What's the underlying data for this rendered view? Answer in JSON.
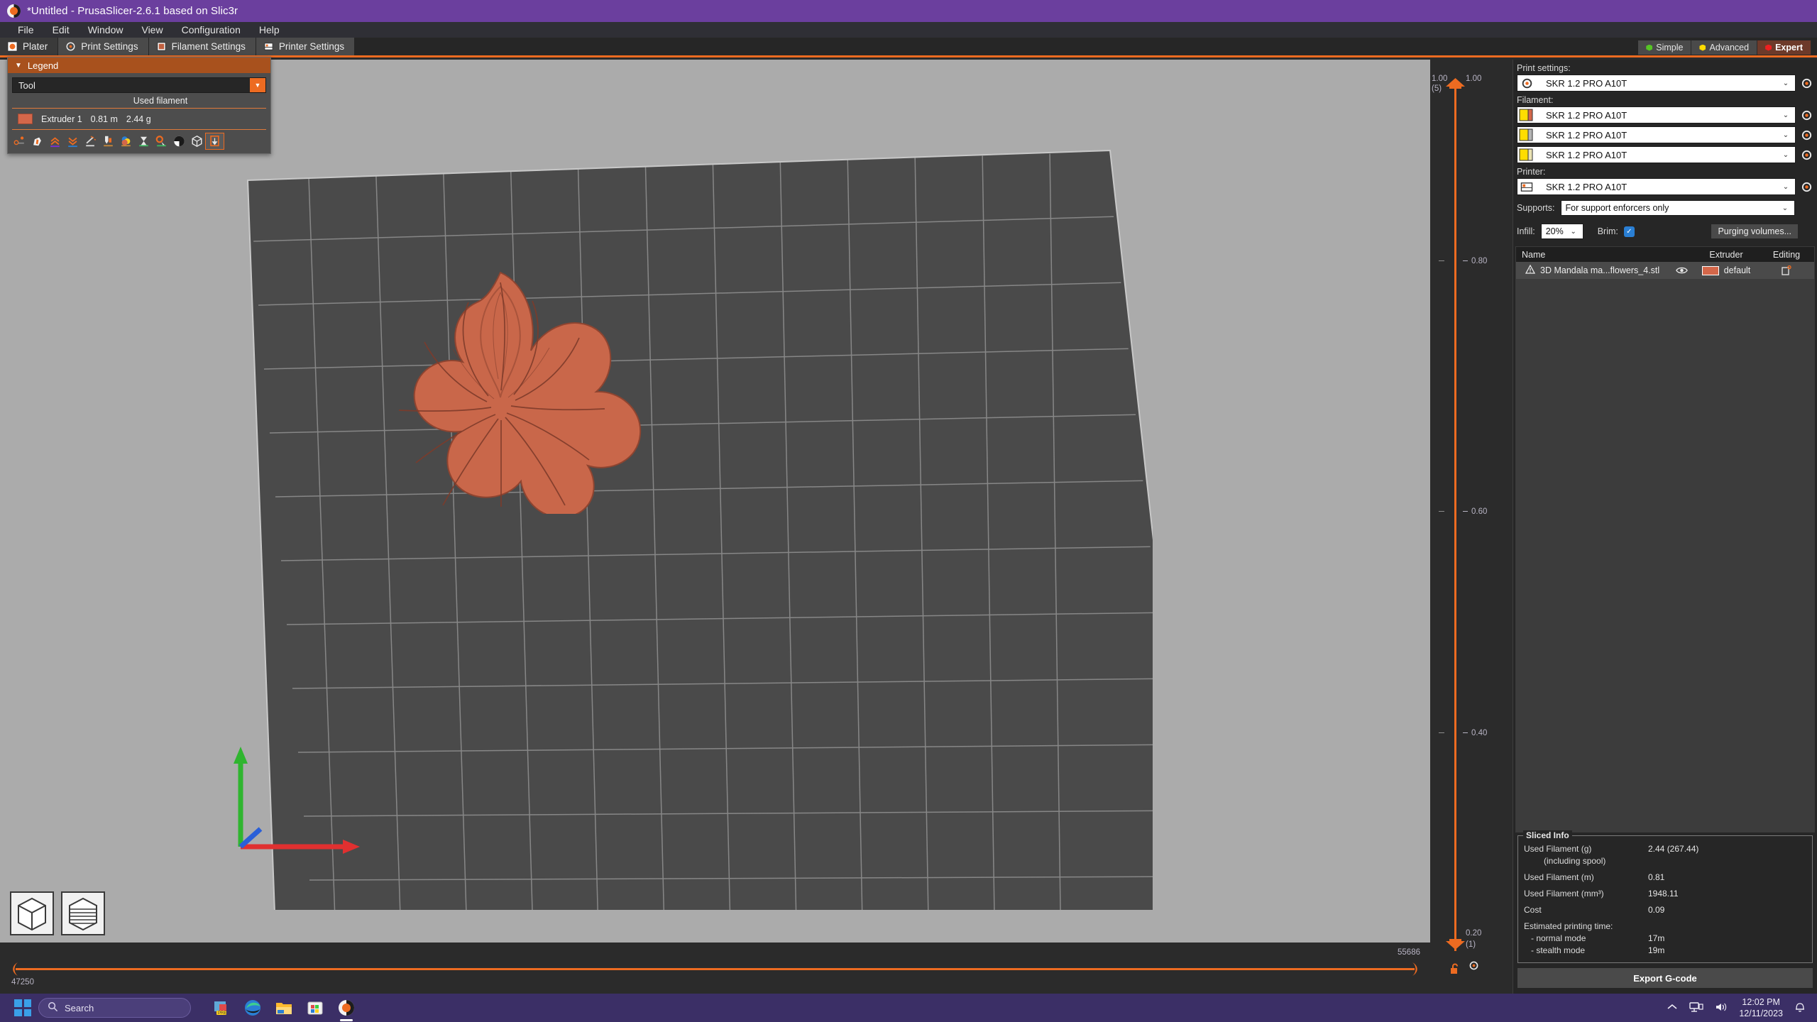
{
  "window": {
    "title": "*Untitled - PrusaSlicer-2.6.1 based on Slic3r",
    "logo_icon": "prusaslicer-logo-icon"
  },
  "menu": {
    "items": [
      {
        "label": "File"
      },
      {
        "label": "Edit"
      },
      {
        "label": "Window"
      },
      {
        "label": "View"
      },
      {
        "label": "Configuration"
      },
      {
        "label": "Help"
      }
    ]
  },
  "tabs": [
    {
      "label": "Plater",
      "icon": "plater-icon",
      "active": true
    },
    {
      "label": "Print Settings",
      "icon": "print-settings-icon",
      "active": false
    },
    {
      "label": "Filament Settings",
      "icon": "filament-settings-icon",
      "active": false
    },
    {
      "label": "Printer Settings",
      "icon": "printer-settings-icon",
      "active": false
    }
  ],
  "modes": [
    {
      "label": "Simple",
      "color": "#56c425",
      "active": false
    },
    {
      "label": "Advanced",
      "color": "#ffdc00",
      "active": false
    },
    {
      "label": "Expert",
      "color": "#ed2020",
      "active": true
    }
  ],
  "legend": {
    "title": "Legend",
    "collapse_icon": "triangle-down-icon",
    "view_type": "Tool",
    "column_header": "Used filament",
    "rows": [
      {
        "name": "Extruder 1",
        "length": "0.81 m",
        "weight": "2.44 g",
        "color": "#d4674a"
      }
    ],
    "toolbar_icons": [
      "travel-icon",
      "retractions-icon",
      "seams-icon",
      "deretractions-icon",
      "wipe-icon",
      "tool-changes-icon",
      "color-changes-icon",
      "pause-prints-icon",
      "custom-gcodes-icon",
      "shells-icon",
      "legend-icon",
      "tool-marker-icon"
    ]
  },
  "viewport": {
    "model_color": "#c9674a",
    "bed_color": "#4a4a4a",
    "background_color": "#ababab",
    "axes": {
      "x_color": "#e03030",
      "y_color": "#2fb52f",
      "z_color": "#2a5fd8"
    },
    "view_cubes": [
      "solid-view-cube-icon",
      "layers-view-cube-icon"
    ]
  },
  "vertical_slider": {
    "top_value": "1.00",
    "top_layer": "(5)",
    "top_value_right": "1.00",
    "bottom_value": "0.20",
    "bottom_layer": "(1)",
    "ticks": [
      "0.80",
      "0.60",
      "0.40"
    ],
    "lock_icon": "lock-open-icon",
    "gear_icon": "gear-icon",
    "color": "#ed6b21"
  },
  "horizontal_slider": {
    "left_value": "47250",
    "right_value": "55686",
    "color": "#ed6b21"
  },
  "right_panel": {
    "print_settings": {
      "label": "Print settings:",
      "value": "SKR 1.2 PRO A10T",
      "icon": "print-settings-icon",
      "gear_icon": "gear-icon"
    },
    "filament": {
      "label": "Filament:",
      "items": [
        {
          "value": "SKR 1.2 PRO A10T",
          "color_a": "#ffdd00",
          "color_b": "#d4674a"
        },
        {
          "value": "SKR 1.2 PRO A10T",
          "color_a": "#ffdd00",
          "color_b": "#b5b5b5"
        },
        {
          "value": "SKR 1.2 PRO A10T",
          "color_a": "#ffdd00",
          "color_b": "#ebe3b4"
        }
      ],
      "gear_icon": "gear-icon"
    },
    "printer": {
      "label": "Printer:",
      "value": "SKR 1.2 PRO A10T",
      "icon": "printer-icon",
      "gear_icon": "gear-icon"
    },
    "supports": {
      "label": "Supports:",
      "value": "For support enforcers only"
    },
    "infill": {
      "label": "Infill:",
      "value": "20%"
    },
    "brim": {
      "label": "Brim:",
      "checked": true,
      "check_icon": "check-icon"
    },
    "purging_button": "Purging volumes...",
    "object_list": {
      "columns": [
        "Name",
        "Extruder",
        "Editing"
      ],
      "rows": [
        {
          "name": "3D Mandala ma...flowers_4.stl",
          "warning_icon": "warning-triangle-icon",
          "eye_icon": "eye-icon",
          "extruder": "default",
          "extruder_color": "#d4674a",
          "editing_icon": "editing-icon"
        }
      ]
    },
    "sliced_info": {
      "title": "Sliced Info",
      "rows": [
        {
          "key": "Used Filament (g)",
          "value": "2.44 (267.44)",
          "indent": 0
        },
        {
          "key": "(including spool)",
          "value": "",
          "indent": 1
        },
        {
          "key": "Used Filament (m)",
          "value": "0.81",
          "indent": 0
        },
        {
          "key": "Used Filament (mm³)",
          "value": "1948.11",
          "indent": 0
        },
        {
          "key": "Cost",
          "value": "0.09",
          "indent": 0
        },
        {
          "key": "Estimated printing time:",
          "value": "",
          "indent": 0
        },
        {
          "key": "- normal mode",
          "value": "17m",
          "indent": 2
        },
        {
          "key": "- stealth mode",
          "value": "19m",
          "indent": 2
        }
      ]
    },
    "export_button": "Export G-code"
  },
  "taskbar": {
    "start_icon": "windows-start-icon",
    "search_placeholder": "Search",
    "search_icon": "search-icon",
    "apps": [
      {
        "name": "presentation-app-icon",
        "active": false
      },
      {
        "name": "edge-browser-icon",
        "active": false
      },
      {
        "name": "file-explorer-icon",
        "active": false
      },
      {
        "name": "microsoft-store-icon",
        "active": false
      },
      {
        "name": "prusaslicer-taskbar-icon",
        "active": true
      }
    ],
    "tray": {
      "chevron_icon": "chevron-up-icon",
      "network_icon": "network-icon",
      "volume_icon": "volume-icon",
      "time": "12:02 PM",
      "date": "12/11/2023",
      "notification_icon": "bell-icon"
    }
  }
}
